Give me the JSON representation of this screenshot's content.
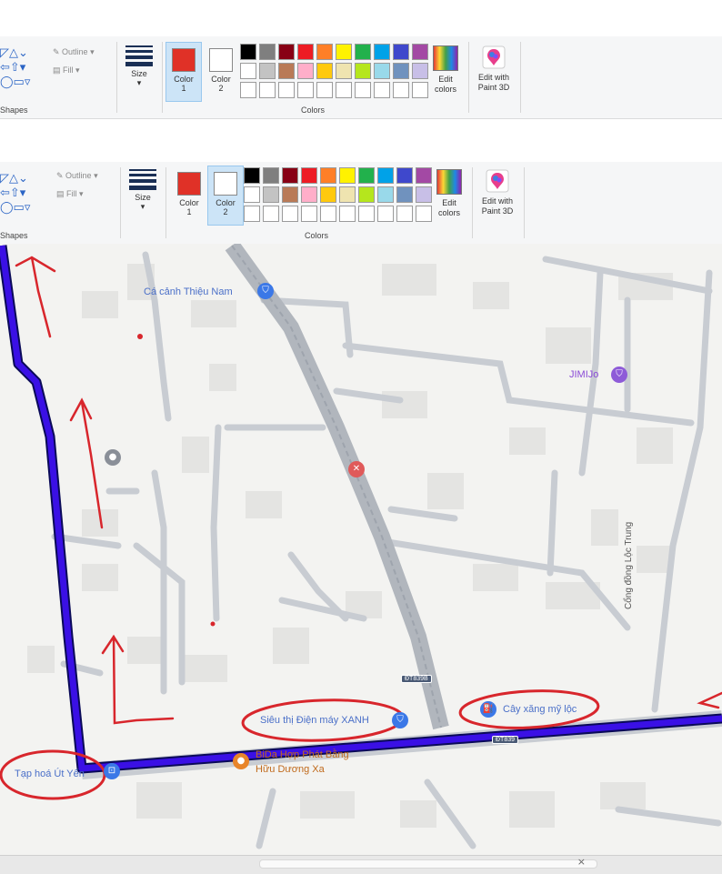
{
  "ribbons": [
    {
      "outline_label": "Outline",
      "fill_label": "Fill",
      "shapes_label": "Shapes",
      "size_label": "Size",
      "color1_label_a": "Color",
      "color1_label_b": "1",
      "color2_label_a": "Color",
      "color2_label_b": "2",
      "colors_label": "Colors",
      "edit_colors_a": "Edit",
      "edit_colors_b": "colors",
      "paint3d_a": "Edit with",
      "paint3d_b": "Paint 3D",
      "selected_color": "color1"
    },
    {
      "outline_label": "Outline",
      "fill_label": "Fill",
      "shapes_label": "Shapes",
      "size_label": "Size",
      "color1_label_a": "Color",
      "color1_label_b": "1",
      "color2_label_a": "Color",
      "color2_label_b": "2",
      "colors_label": "Colors",
      "edit_colors_a": "Edit",
      "edit_colors_b": "colors",
      "paint3d_a": "Edit with",
      "paint3d_b": "Paint 3D",
      "selected_color": "color2"
    }
  ],
  "colors": {
    "color1": "#e03127",
    "color2": "#ffffff",
    "palette_row1": [
      "#000000",
      "#7f7f7f",
      "#880015",
      "#ed1c24",
      "#ff7f27",
      "#fff200",
      "#22b14c",
      "#00a2e8",
      "#3f48cc",
      "#a349a4"
    ],
    "palette_row2": [
      "#ffffff",
      "#c3c3c3",
      "#b97a57",
      "#ffaec9",
      "#ffc90e",
      "#efe4b0",
      "#b5e61d",
      "#99d9ea",
      "#7092be",
      "#c8bfe7"
    ],
    "palette_row3": [
      "#ffffff",
      "#ffffff",
      "#ffffff",
      "#ffffff",
      "#ffffff",
      "#ffffff",
      "#ffffff",
      "#ffffff",
      "#ffffff",
      "#ffffff"
    ],
    "route": "#3a10e5",
    "annotation": "#d8262c",
    "road": "#c8ccd2",
    "highway": "#a9b0ba"
  },
  "map": {
    "places": [
      {
        "name": "Cá cảnh Thiệu Nam",
        "icon": "shopping-bag-icon"
      },
      {
        "name": "JIMIJo",
        "icon": "shopping-bag-icon"
      },
      {
        "name": "Siêu thị Điện máy XANH",
        "icon": "shopping-bag-icon"
      },
      {
        "name": "Cây xăng mỹ lộc",
        "icon": "gas-station-icon"
      },
      {
        "name": "Tạp hoá Út Yến",
        "icon": "shopping-cart-icon"
      },
      {
        "name": "BiDa Hợp Phát Bằng",
        "icon": "pool-icon"
      },
      {
        "name": "Hữu Dương Xa",
        "icon": "pool-icon"
      }
    ],
    "street_label": "Cổng đồng Lộc Trung",
    "road_shield_1": "ĐT839B",
    "road_shield_2": "ĐT839"
  },
  "window": {
    "close_glyph": "×"
  }
}
